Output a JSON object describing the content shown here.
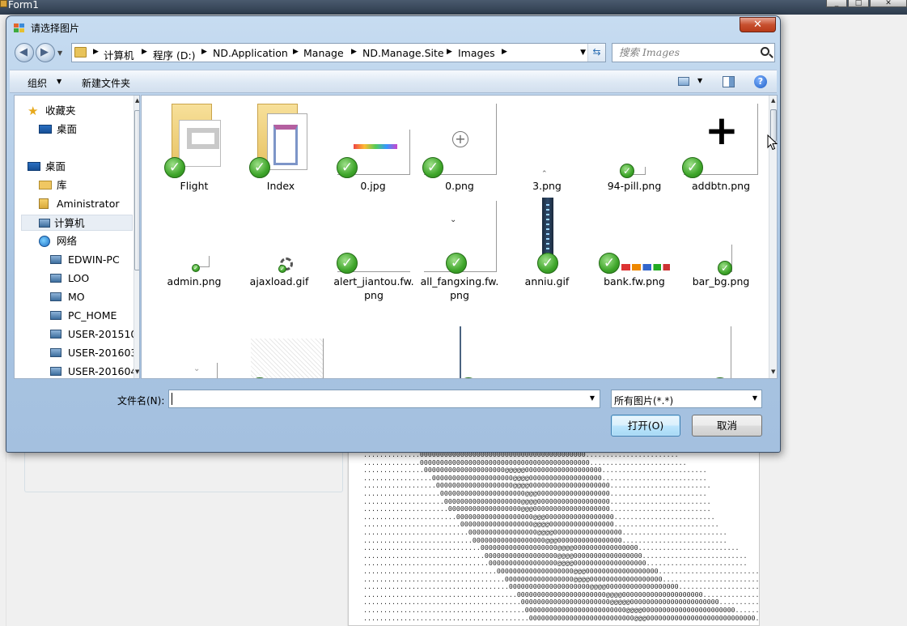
{
  "background_form": {
    "title": "Form1",
    "ascii_lines": [
      "..............00000000000000000000000000000000000000000.......................",
      "..............000000000000000000000000000000000000000000........................",
      "...............00000000000000000000@@@@@0000000000000000000..........................",
      ".................00000000000000000000@@@@000000000000000000..........................",
      "..................0000000000000000000@@@@00000000000000000000.........................",
      "...................000000000000000000000@@@000000000000000000........................",
      "....................0000000000000000000@@@@000000000000000000.........................",
      ".....................000000000000000000@@@0000000000000000000.........................",
      ".......................0000000000000000000@@@00000000000000000.........................",
      "........................000000000000000000@@@@0000000000000000..........................",
      "..........................00000000000000000@@@@00000000000000000..........................",
      "...........................000000000000000000@@@0000000000000000..........................",
      ".............................0000000000000000000@@@@0000000000000000.........................",
      "..............................000000000000000000@@@@00000000000000000..........................",
      "...............................00000000000000000@@@@000000000000000000.........................",
      ".................................0000000000000000000@@@000000000000000000..........................",
      "...................................00000000000000000@@@@000000000000000000..........................",
      "....................................00000000000000000000@@@@000000000000000000.......................",
      "......................................0000000000000000000000@@@@00000000000000000000.....................",
      ".......................................0000000000000000000000@@@@@0000000000000000000000..................",
      "........................................0000000000000000000000000@@@@00000000000000000000000.................",
      ".........................................00000000000000000000000000@@@000000000000000000000000000..............."
    ],
    "window_controls": [
      "_",
      "□",
      "✕"
    ]
  },
  "dialog": {
    "title": "请选择图片",
    "close_label": "✕",
    "breadcrumbs": [
      "计算机",
      "程序 (D:)",
      "ND.Application",
      "Manage",
      "ND.Manage.Site",
      "Images"
    ],
    "search_placeholder": "搜索 Images",
    "toolbar": {
      "organize_label": "组织",
      "new_folder_label": "新建文件夹"
    },
    "nav": [
      {
        "label": "收藏夹",
        "icon": "star-icon"
      },
      {
        "label": "桌面",
        "icon": "desktop-icon"
      },
      {
        "label": "桌面",
        "icon": "desktop-icon"
      },
      {
        "label": "库",
        "icon": "library-icon"
      },
      {
        "label": "Aministrator",
        "icon": "user-folder-icon"
      },
      {
        "label": "计算机",
        "icon": "computer-icon",
        "selected": true
      },
      {
        "label": "网络",
        "icon": "network-icon"
      },
      {
        "label": "EDWIN-PC",
        "icon": "computer-icon"
      },
      {
        "label": "LOO",
        "icon": "computer-icon"
      },
      {
        "label": "MO",
        "icon": "computer-icon"
      },
      {
        "label": "PC_HOME",
        "icon": "computer-icon"
      },
      {
        "label": "USER-201510",
        "icon": "computer-icon"
      },
      {
        "label": "USER-201603",
        "icon": "computer-icon"
      },
      {
        "label": "USER-201604",
        "icon": "computer-icon"
      }
    ],
    "files_row1": [
      "Flight",
      "Index",
      "0.jpg",
      "0.png",
      "3.png",
      "94-pill.png",
      "addbtn.png"
    ],
    "files_row2": [
      "admin.png",
      "ajaxload.gif",
      "alert_jiantou.fw.\npng",
      "all_fangxing.fw.\npng",
      "anniu.gif",
      "bank.fw.png",
      "bar_bg.png"
    ],
    "filename_label": "文件名(N):",
    "filename_value": "",
    "filetype_value": "所有图片(*.*)",
    "open_label": "打开(O)",
    "cancel_label": "取消"
  },
  "colors": {
    "dialog_frame": "#a9c5e3",
    "close_button": "#c7502f",
    "checkmark": "#3ea52a",
    "folder": "#edcf7c"
  }
}
